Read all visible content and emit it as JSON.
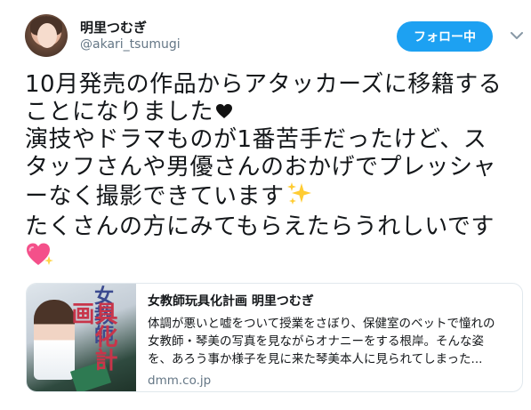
{
  "user": {
    "display_name": "明里つむぎ",
    "handle": "@akari_tsumugi"
  },
  "follow_button": {
    "label": "フォロー中",
    "color": "#1da1f2"
  },
  "more_menu": {
    "icon": "chevron-down-icon"
  },
  "tweet": {
    "lines": [
      "10月発売の作品からアタッカーズに移籍する",
      "ことになりました",
      "演技やドラマものが1番苦手だったけど、ス",
      "タッフさんや男優さんのおかげでプレッシャ",
      "ーなく撮影できています",
      "たくさんの方にみてもらえたらうれしいです"
    ],
    "emojis": [
      "black-heart-icon",
      "sparkles-icon",
      "sparkling-heart-icon"
    ]
  },
  "card": {
    "image_text_1": "女教師",
    "image_text_2": "具化計画",
    "title": "女教師玩具化計画 明里つむぎ",
    "description_lines": [
      "体調が悪いと嘘をついて授業をさぼり、保健室のベットで憧れの",
      "女教師・琴美の写真を見ながらオナニーをする根岸。そんな姿",
      "を、あろう事か様子を見に来た琴美本人に見られてしまった..."
    ],
    "domain": "dmm.co.jp"
  }
}
